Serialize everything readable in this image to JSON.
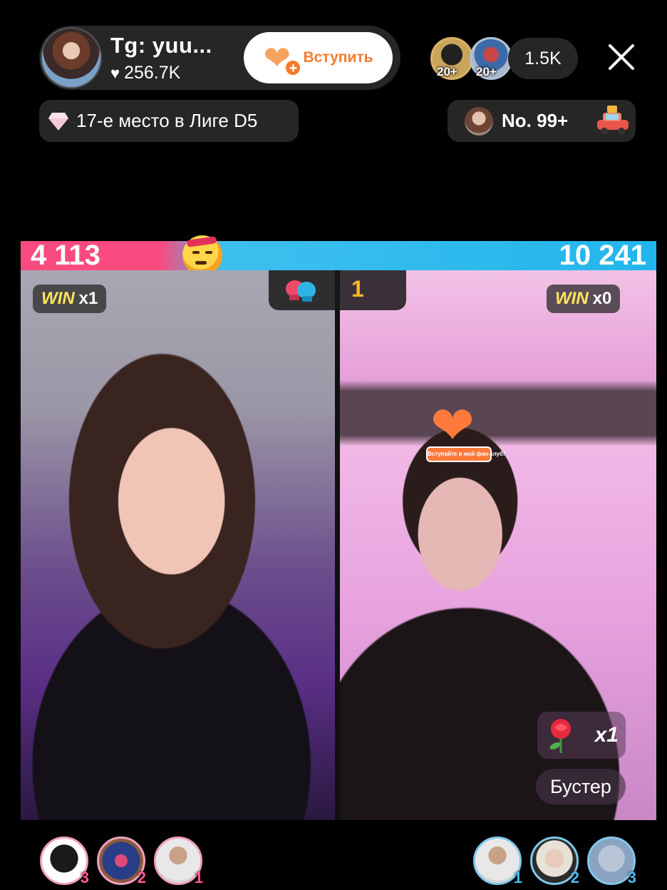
{
  "host": {
    "name": "Tg: yuu...",
    "likes": "256.7K",
    "join_label": "Вступить"
  },
  "viewers": {
    "top": [
      {
        "badge": "20+"
      },
      {
        "badge": "20+"
      }
    ],
    "count": "1.5K"
  },
  "league": {
    "text": "17-е место в Лиге D5"
  },
  "rank": {
    "text": "No. 99+"
  },
  "battle": {
    "score_left": "4 113",
    "score_right": "10 241",
    "round": "1",
    "left_win_label": "WIN",
    "left_win_count": "x1",
    "right_win_label": "WIN",
    "right_win_count": "x0",
    "fan_club_tag": "Вступайте в мой фан-клуб!",
    "gift_multiplier": "x1",
    "booster_label": "Бустер"
  },
  "supporters": {
    "left": [
      {
        "rank": "3"
      },
      {
        "rank": "2"
      },
      {
        "rank": "1"
      }
    ],
    "right": [
      {
        "rank": "1"
      },
      {
        "rank": "2"
      },
      {
        "rank": "3"
      }
    ]
  },
  "colors": {
    "left_team": "#f94b7f",
    "right_team": "#22b6ec",
    "join_accent": "#f37c2e",
    "win_text": "#ffe55a"
  },
  "icons": [
    "heart-icon",
    "diamond-icon",
    "close-icon",
    "car-icon",
    "gloves-icon",
    "rose-icon",
    "angry-emoji-icon"
  ]
}
